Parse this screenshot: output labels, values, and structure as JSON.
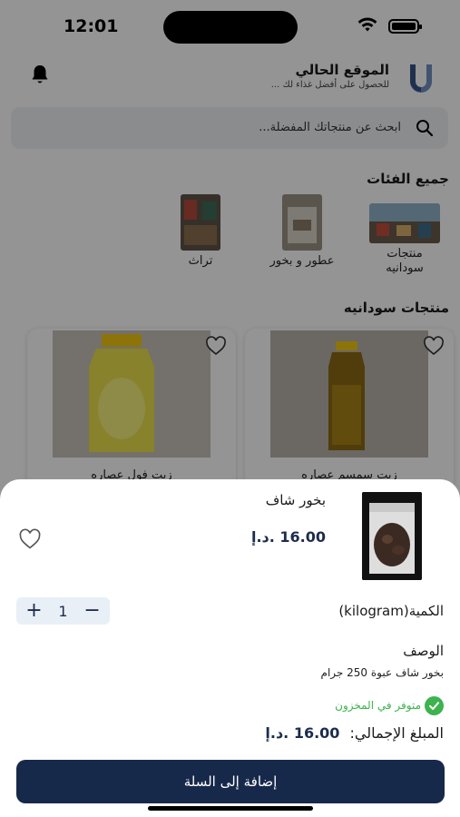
{
  "status_bar": {
    "time": "12:01"
  },
  "header": {
    "location_title": "الموقع الحالي",
    "location_subtitle": "للحصول على أفضل غذاء لك ..."
  },
  "search": {
    "placeholder": "ابحث عن منتجاتك المفضلة..."
  },
  "categories": {
    "title": "جميع الفئات",
    "items": [
      {
        "label": "منتجات سودانيه"
      },
      {
        "label": "عطور و بخور"
      },
      {
        "label": "تراث"
      }
    ]
  },
  "products": {
    "title": "منتجات سودانيه",
    "items": [
      {
        "name": "زيت سمسم عصاره"
      },
      {
        "name": "زيت فول عصاره"
      }
    ]
  },
  "sheet": {
    "product_name": "بخور شاف",
    "price": "16.00 .د.إ",
    "quantity_label": "الكمية(kilogram)",
    "quantity": "1",
    "description_title": "الوصف",
    "description": "بخور شاف عبوة 250 جرام",
    "stock_status": "متوفر في المخزون",
    "total_label": "المبلغ الإجمالي:",
    "total_value": "16.00 .د.إ",
    "add_to_cart": "إضافة إلى السلة"
  },
  "colors": {
    "primary": "#17294a",
    "price": "#1c2c4c",
    "in_stock": "#3db24f",
    "stepper_bg": "#e9eff6"
  }
}
